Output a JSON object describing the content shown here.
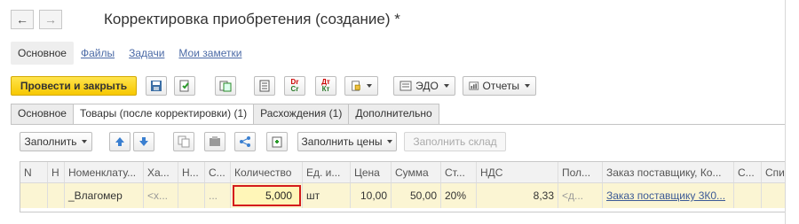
{
  "window": {
    "title": "Корректировка приобретения (создание) *"
  },
  "nav": {
    "back": "←",
    "forward": "→"
  },
  "top_tabs": [
    {
      "label": "Основное",
      "active": true
    },
    {
      "label": "Файлы",
      "active": false
    },
    {
      "label": "Задачи",
      "active": false
    },
    {
      "label": "Мои заметки",
      "active": false
    }
  ],
  "toolbar": {
    "post_close": "Провести и закрыть",
    "edo": "ЭДО",
    "reports": "Отчеты",
    "dt": "Дт",
    "kt": "Кт",
    "dr": "Dr",
    "cr": "Cr"
  },
  "tabs": [
    {
      "label": "Основное"
    },
    {
      "label": "Товары (после корректировки) (1)"
    },
    {
      "label": "Расхождения (1)"
    },
    {
      "label": "Дополнительно"
    }
  ],
  "tab_toolbar": {
    "fill": "Заполнить",
    "fill_prices": "Заполнить цены",
    "fill_warehouse": "Заполнить склад"
  },
  "table": {
    "headers": [
      "N",
      "Н",
      "Номенклату...",
      "Ха...",
      "Н...",
      "С...",
      "Количество",
      "Ед. и...",
      "Цена",
      "Сумма",
      "Ст...",
      "НДС",
      "Пол...",
      "Заказ поставщику, Ко...",
      "С...",
      "Спи"
    ],
    "row": {
      "nomenclature": "_Влагомер",
      "characteristic": "<х...",
      "series": "...",
      "quantity": "5,000",
      "unit": "шт",
      "price": "10,00",
      "sum": "50,00",
      "vat_rate": "20%",
      "vat": "8,33",
      "recipient": "<д...",
      "order": "Заказ поставщику 3К0..."
    }
  },
  "colors": {
    "primary_button": "#f7c800",
    "highlight": "#d41c1c",
    "row_bg": "#fbf5d3"
  }
}
